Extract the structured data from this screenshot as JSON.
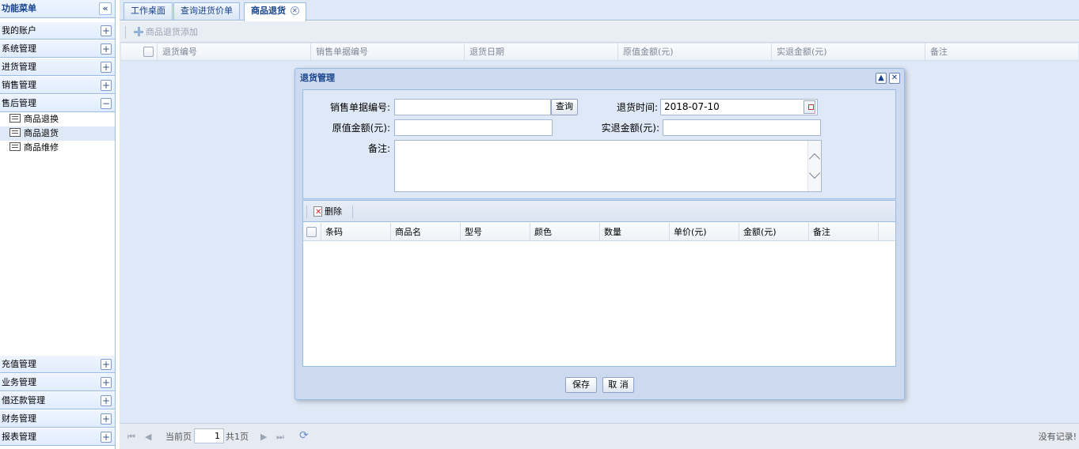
{
  "sidebar": {
    "title": "功能菜单",
    "collapse_glyph": "«",
    "sections_top": [
      {
        "label": "我的账户",
        "btn": "+"
      },
      {
        "label": "系统管理",
        "btn": "+"
      },
      {
        "label": "进货管理",
        "btn": "+"
      },
      {
        "label": "销售管理",
        "btn": "+"
      },
      {
        "label": "售后管理",
        "btn": "−"
      }
    ],
    "tree_items": [
      {
        "label": "商品退换",
        "selected": false
      },
      {
        "label": "商品退货",
        "selected": true
      },
      {
        "label": "商品维修",
        "selected": false
      }
    ],
    "sections_bottom": [
      {
        "label": "充值管理",
        "btn": "+"
      },
      {
        "label": "业务管理",
        "btn": "+"
      },
      {
        "label": "借还款管理",
        "btn": "+"
      },
      {
        "label": "财务管理",
        "btn": "+"
      },
      {
        "label": "报表管理",
        "btn": "+"
      }
    ]
  },
  "tabs": [
    {
      "label": "工作桌面",
      "active": false
    },
    {
      "label": "查询进货价单",
      "active": false
    },
    {
      "label": "商品退货",
      "active": true,
      "close_glyph": "✕"
    }
  ],
  "toolbar": {
    "add_label": "商品退货添加"
  },
  "main_grid": {
    "columns": [
      "退货编号",
      "销售单据编号",
      "退货日期",
      "原值金额(元)",
      "实退金额(元)",
      "备注"
    ]
  },
  "pager": {
    "current_label": "当前页",
    "page_value": "1",
    "total_label": "共1页",
    "empty_label": "没有记录!"
  },
  "dialog": {
    "title": "退货管理",
    "collapse_glyph": "▲",
    "close_glyph": "✕",
    "form": {
      "sale_no_label": "销售单据编号:",
      "sale_no_value": "",
      "query_button": "查询",
      "return_time_label": "退货时间:",
      "return_time_value": "2018-07-10",
      "orig_amount_label": "原值金额(元):",
      "orig_amount_value": "",
      "refund_amount_label": "实退金额(元):",
      "refund_amount_value": "",
      "remark_label": "备注:",
      "remark_value": ""
    },
    "grid": {
      "delete_label": "删除",
      "columns": [
        "条码",
        "商品名",
        "型号",
        "颜色",
        "数量",
        "单价(元)",
        "金额(元)",
        "备注"
      ],
      "rows": []
    },
    "save_button": "保存",
    "cancel_button": "取 消"
  },
  "colors": {
    "accent": "#15428b",
    "border": "#99bbe8",
    "panel": "#dfe8f6"
  }
}
